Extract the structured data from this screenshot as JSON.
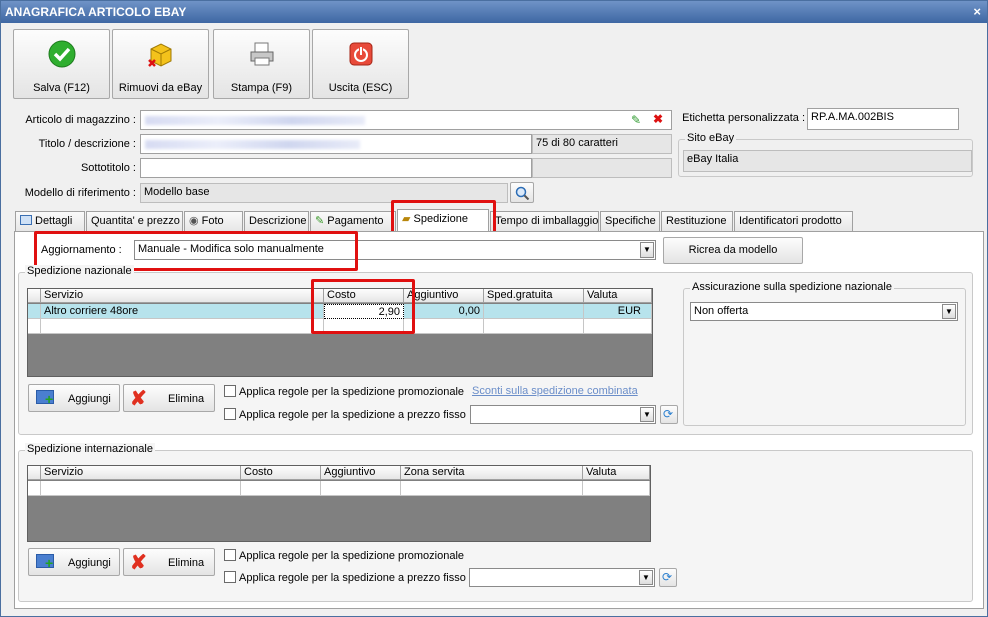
{
  "window": {
    "title": "ANAGRAFICA ARTICOLO EBAY",
    "close_glyph": "×"
  },
  "toolbar": {
    "save_label": "Salva (F12)",
    "remove_label": "Rimuovi da eBay",
    "print_label": "Stampa (F9)",
    "exit_label": "Uscita (ESC)"
  },
  "form": {
    "article_label": "Articolo di magazzino :",
    "title_label": "Titolo / descrizione :",
    "subtitle_label": "Sottotitolo :",
    "model_label": "Modello di riferimento :",
    "model_value": "Modello base",
    "char_count": "75 di 80 caratteri",
    "custom_label_label": "Etichetta personalizzata :",
    "custom_label_value": "RP.A.MA.002BIS",
    "site_group_title": "Sito eBay",
    "site_value": "eBay Italia"
  },
  "tabs": [
    "Dettagli",
    "Quantita' e prezzo",
    "Foto",
    "Descrizione",
    "Pagamento",
    "Spedizione",
    "Tempo di imballaggio",
    "Specifiche",
    "Restituzione",
    "Identificatori prodotto"
  ],
  "shipping": {
    "update_label": "Aggiornamento :",
    "update_value": "Manuale - Modifica solo manualmente",
    "recreate_label": "Ricrea da modello",
    "national_title": "Spedizione nazionale",
    "national_columns": [
      "Servizio",
      "Costo",
      "Aggiuntivo",
      "Sped.gratuita",
      "Valuta"
    ],
    "national_row": {
      "service": "Altro corriere 48ore",
      "cost": "2,90",
      "additional": "0,00",
      "free": "",
      "currency": "EUR"
    },
    "insurance_title": "Assicurazione sulla spedizione nazionale",
    "insurance_value": "Non offerta",
    "add_label": "Aggiungi",
    "delete_label": "Elimina",
    "promo_rules_label": "Applica regole per la spedizione promozionale",
    "fixed_rules_label": "Applica regole per la spedizione a prezzo fisso",
    "combined_discount_link": "Sconti sulla spedizione combinata",
    "international_title": "Spedizione internazionale",
    "international_columns": [
      "Servizio",
      "Costo",
      "Aggiuntivo",
      "Zona servita",
      "Valuta"
    ]
  },
  "colors": {
    "titlebar": "#3e67a3",
    "highlight": "#e01010",
    "row_selected": "#b7e3ec"
  }
}
